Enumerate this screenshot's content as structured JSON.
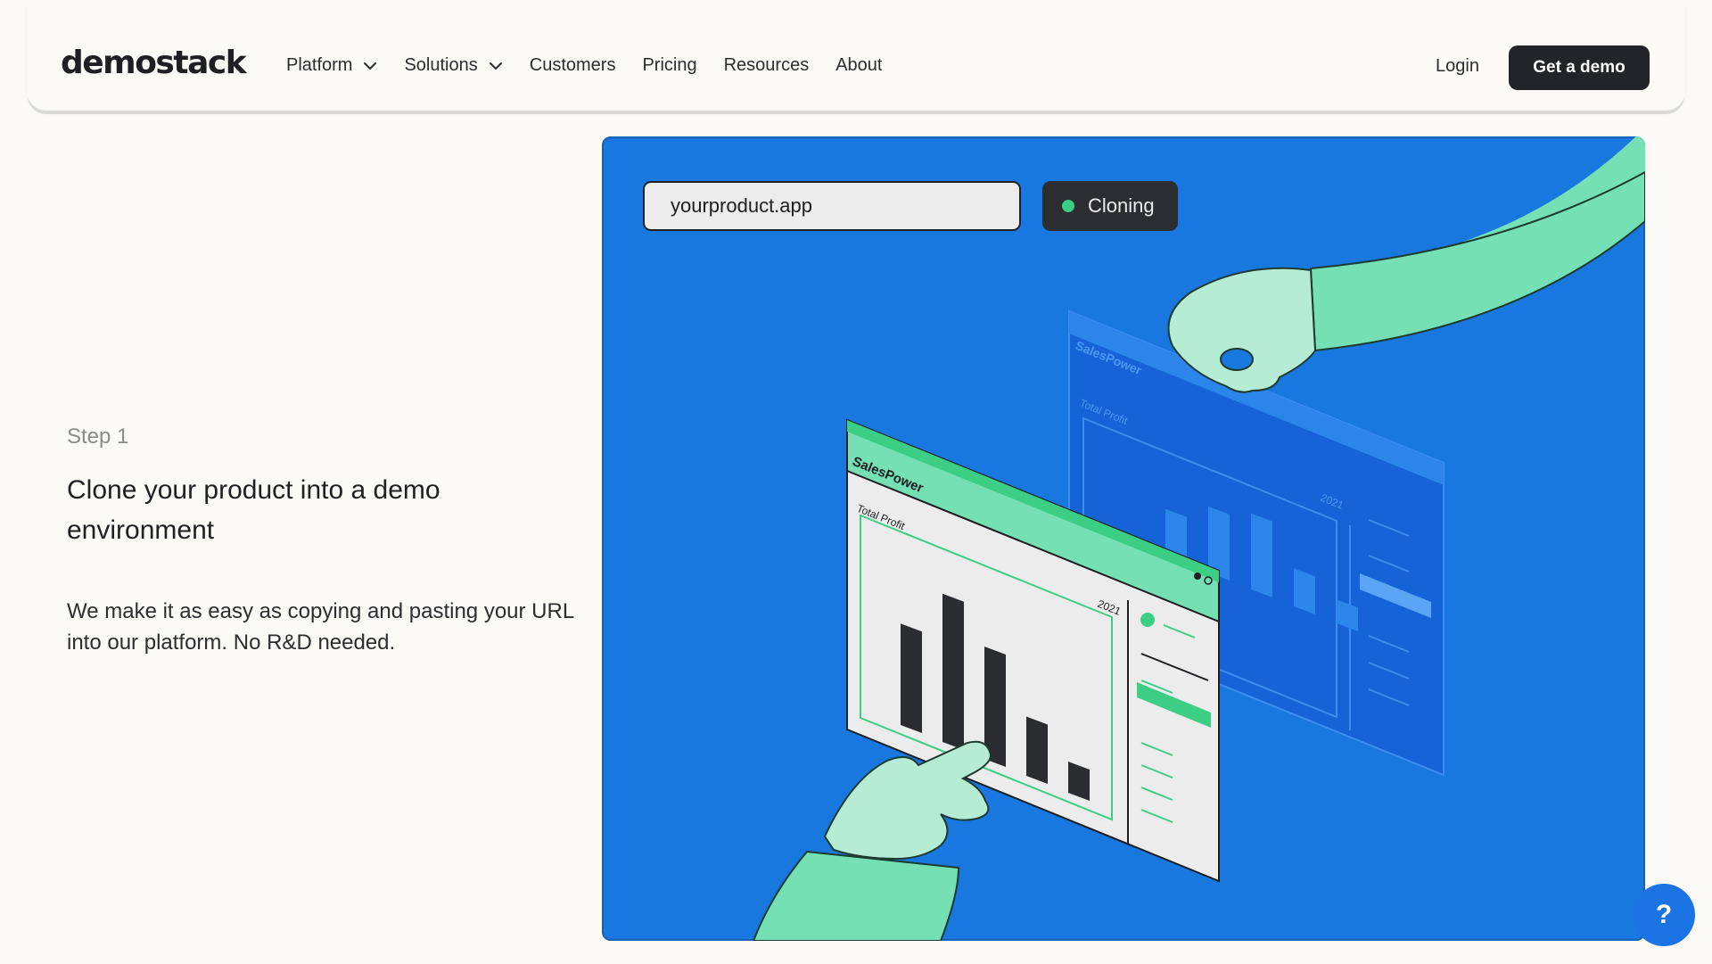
{
  "header": {
    "logo": "demostack",
    "nav": [
      {
        "label": "Platform",
        "has_dropdown": true,
        "icon": "chevron-down-icon"
      },
      {
        "label": "Solutions",
        "has_dropdown": true,
        "icon": "chevron-down-icon"
      },
      {
        "label": "Customers",
        "has_dropdown": false
      },
      {
        "label": "Pricing",
        "has_dropdown": false
      },
      {
        "label": "Resources",
        "has_dropdown": false
      },
      {
        "label": "About",
        "has_dropdown": false
      }
    ],
    "login_label": "Login",
    "cta_label": "Get a demo"
  },
  "step": {
    "label": "Step 1",
    "heading": "Clone your product into a demo environment",
    "body": "We make it as easy as copying and pasting your URL into our platform. No R&D needed."
  },
  "illustration": {
    "url_value": "yourproduct.app",
    "status_label": "Cloning",
    "status_color": "#3dce86",
    "panel_color": "#1978df",
    "front_app_title": "SalesPower",
    "front_chart_title": "Total Profit",
    "front_chart_year": "2021",
    "front_bars": [
      0.65,
      0.95,
      0.72,
      0.38,
      0.2
    ],
    "back_app_title": "SalesPower",
    "back_chart_title": "Total Profit",
    "back_chart_year": "2021",
    "back_bars": [
      0.55,
      0.78,
      0.9,
      0.45,
      0.28
    ]
  },
  "help": {
    "label": "?",
    "icon": "help-icon"
  },
  "colors": {
    "accent_green": "#74e0b4",
    "dark": "#232427",
    "background": "#fbfaf7"
  }
}
